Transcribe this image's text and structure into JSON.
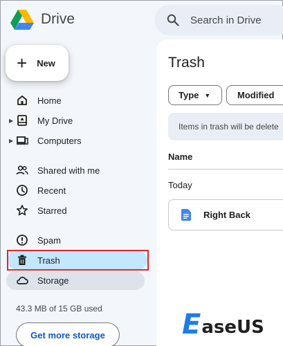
{
  "app": {
    "name": "Drive"
  },
  "search": {
    "placeholder": "Search in Drive"
  },
  "new_button": {
    "label": "New"
  },
  "sidebar": {
    "items": [
      {
        "label": "Home",
        "icon": "home-icon"
      },
      {
        "label": "My Drive",
        "icon": "my-drive-icon",
        "expandable": true
      },
      {
        "label": "Computers",
        "icon": "computers-icon",
        "expandable": true
      },
      {
        "label": "Shared with me",
        "icon": "people-icon"
      },
      {
        "label": "Recent",
        "icon": "clock-icon"
      },
      {
        "label": "Starred",
        "icon": "star-icon"
      },
      {
        "label": "Spam",
        "icon": "spam-icon"
      },
      {
        "label": "Trash",
        "icon": "trash-icon",
        "selected": true
      },
      {
        "label": "Storage",
        "icon": "cloud-icon"
      }
    ],
    "storage_usage": "43.3 MB of 15 GB used",
    "get_storage_label": "Get more storage"
  },
  "main": {
    "title": "Trash",
    "filters": {
      "type_label": "Type",
      "modified_label": "Modified"
    },
    "notice": "Items in trash will be delete",
    "column_header": "Name",
    "group_label": "Today",
    "files": [
      {
        "name": "Right Back",
        "icon": "docs-icon"
      }
    ]
  },
  "watermark": {
    "brand_initial": "E",
    "brand_rest": "aseUS"
  },
  "colors": {
    "selected_bg": "#c2e7ff",
    "highlight_border": "#e0262f",
    "link_blue": "#0b57d0",
    "page_bg": "#f3f6fb",
    "docs_blue": "#4285f4"
  }
}
